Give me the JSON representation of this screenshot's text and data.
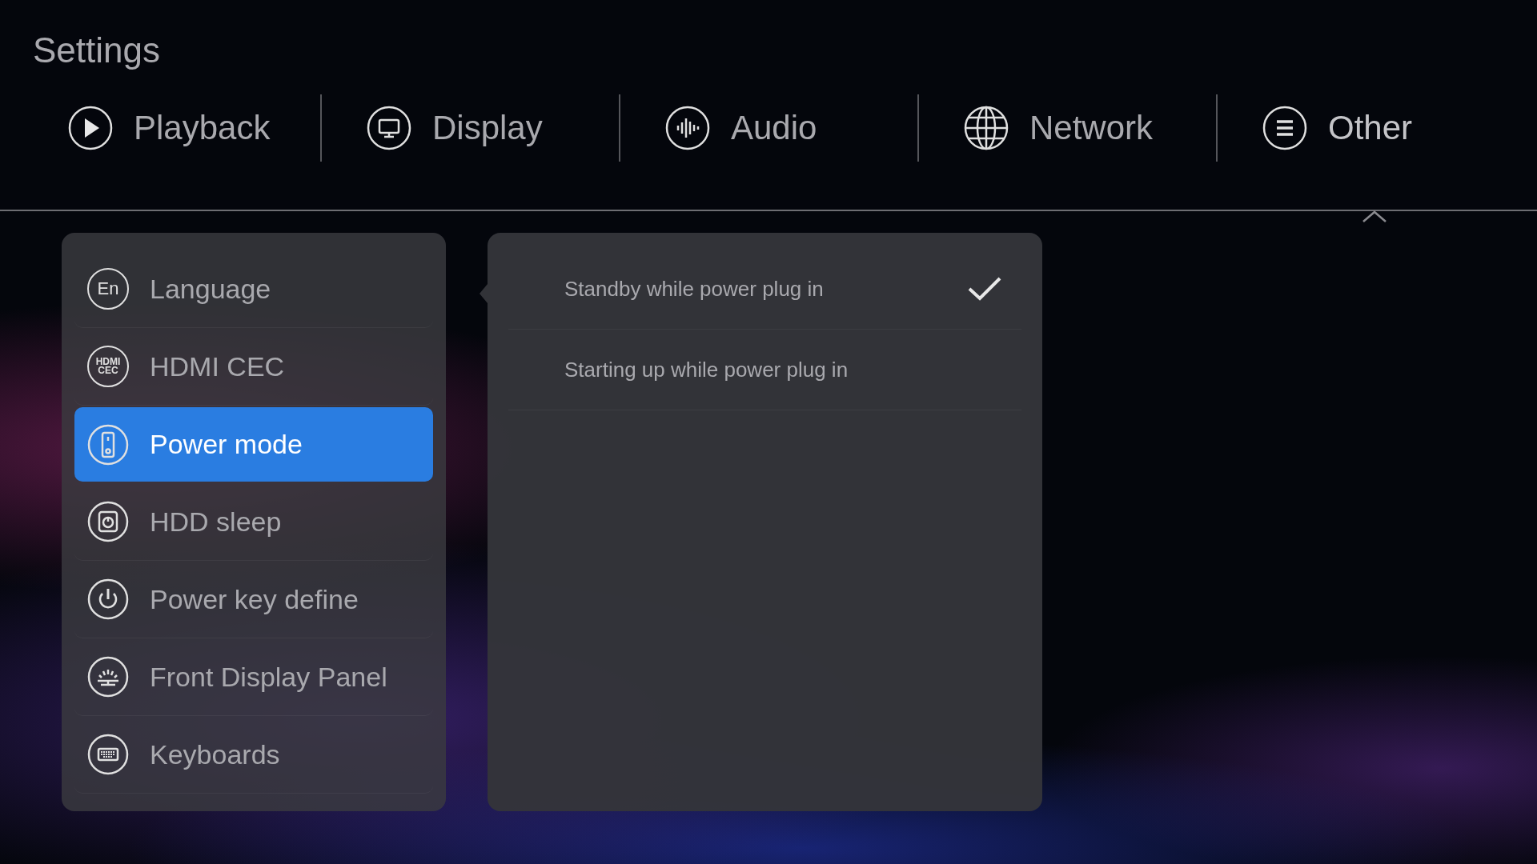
{
  "title": "Settings",
  "tabs": [
    {
      "label": "Playback",
      "selected": false
    },
    {
      "label": "Display",
      "selected": false
    },
    {
      "label": "Audio",
      "selected": false
    },
    {
      "label": "Network",
      "selected": false
    },
    {
      "label": "Other",
      "selected": true
    }
  ],
  "menu": [
    {
      "label": "Language",
      "selected": false,
      "icon_text": [
        "En"
      ]
    },
    {
      "label": "HDMI CEC",
      "selected": false,
      "icon_text": [
        "HDMI",
        "CEC"
      ]
    },
    {
      "label": "Power mode",
      "selected": true
    },
    {
      "label": "HDD sleep",
      "selected": false
    },
    {
      "label": "Power key define",
      "selected": false
    },
    {
      "label": "Front Display Panel",
      "selected": false
    },
    {
      "label": "Keyboards",
      "selected": false
    }
  ],
  "options": [
    {
      "label": "Standby while power plug in",
      "checked": true
    },
    {
      "label": "Starting up while power plug in",
      "checked": false
    }
  ]
}
